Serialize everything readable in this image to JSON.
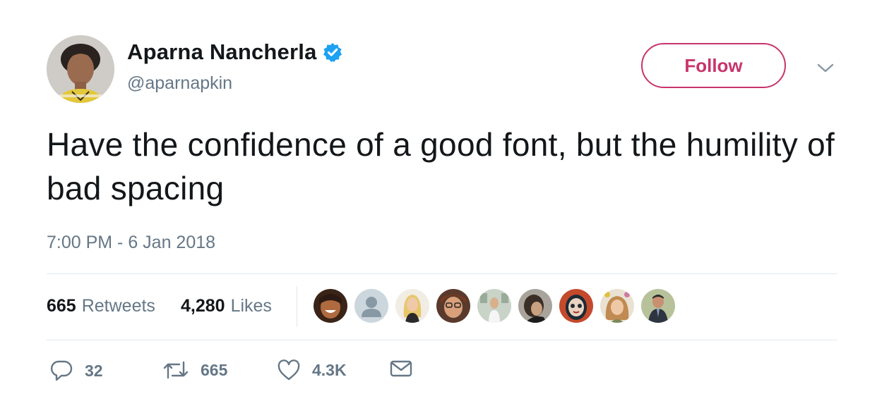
{
  "author": {
    "display_name": "Aparna Nancherla",
    "handle": "@aparnapkin",
    "verified": true
  },
  "follow_button": {
    "label": "Follow",
    "color": "#c8346b"
  },
  "tweet": {
    "text": "Have the confidence of a good font, but the humility of bad spacing",
    "timestamp": "7:00 PM - 6 Jan 2018"
  },
  "stats": {
    "retweets_count": "665",
    "retweets_label": "Retweets",
    "likes_count": "4,280",
    "likes_label": "Likes"
  },
  "likers": [
    {
      "name": "liker-1",
      "color": "#8a4a2c"
    },
    {
      "name": "liker-2",
      "color": "#b8c3cc"
    },
    {
      "name": "liker-3",
      "color": "#e8d9c0"
    },
    {
      "name": "liker-4",
      "color": "#6a4a3a"
    },
    {
      "name": "liker-5",
      "color": "#c9d3c8"
    },
    {
      "name": "liker-6",
      "color": "#8d8b86"
    },
    {
      "name": "liker-7",
      "color": "#2a3a4c"
    },
    {
      "name": "liker-8",
      "color": "#b88b5a"
    },
    {
      "name": "liker-9",
      "color": "#a3b08c"
    }
  ],
  "actions": {
    "reply_count": "32",
    "retweet_count": "665",
    "like_count": "4.3K"
  },
  "colors": {
    "text_primary": "#14171a",
    "text_secondary": "#657786",
    "verified_blue": "#1da1f2",
    "divider": "#e1e8ed"
  },
  "icons": [
    "verified-badge-icon",
    "chevron-down-icon",
    "reply-icon",
    "retweet-icon",
    "heart-icon",
    "envelope-icon"
  ]
}
